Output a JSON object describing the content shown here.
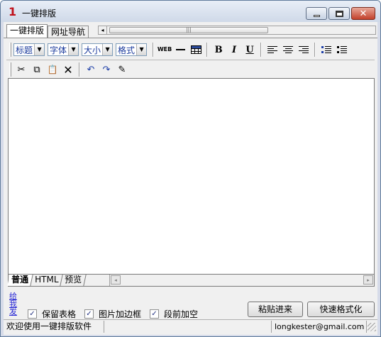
{
  "window": {
    "icon_text": "1",
    "title": "一键排版",
    "minimize_label": "",
    "maximize_label": "",
    "close_label": "✕"
  },
  "top_tabs": [
    {
      "label": "一键排版",
      "active": true
    },
    {
      "label": "网址导航",
      "active": false
    }
  ],
  "top_scrollbar": {
    "left_arrow": "◂",
    "thumb_grip": "|||"
  },
  "toolbar": {
    "dropdowns": [
      {
        "label": "标题",
        "arrow": "▼"
      },
      {
        "label": "字体",
        "arrow": "▼"
      },
      {
        "label": "大小",
        "arrow": "▼"
      },
      {
        "label": "格式",
        "arrow": "▼"
      }
    ],
    "web_icon_text": "WEB",
    "bold_label": "B",
    "italic_label": "I",
    "underline_label": "U"
  },
  "toolbar2": {
    "cut_glyph": "✂",
    "copy_glyph": "⧉",
    "paste_glyph": "📋",
    "delete_glyph": "✕",
    "undo_glyph": "↶",
    "redo_glyph": "↷",
    "edit_glyph": "✎"
  },
  "editor": {
    "content": ""
  },
  "bottom_tabs": [
    {
      "label": "普通",
      "active": true
    },
    {
      "label": "HTML",
      "active": false
    },
    {
      "label": "预览",
      "active": false
    }
  ],
  "bottom_scrollbar": {
    "left_arrow": "◂",
    "right_arrow": "▸"
  },
  "options": {
    "give_link": "给我发",
    "keep_table_label": "保留表格",
    "image_border_label": "图片加边框",
    "paragraph_space_label": "段前加空",
    "keep_table_checked": true,
    "image_border_checked": true,
    "paragraph_space_checked": true,
    "check_glyph": "✓"
  },
  "buttons": {
    "paste_in": "粘贴进来",
    "quick_format": "快速格式化"
  },
  "status": {
    "welcome": "欢迎使用一键排版软件",
    "email": "longkester@gmail.com"
  }
}
